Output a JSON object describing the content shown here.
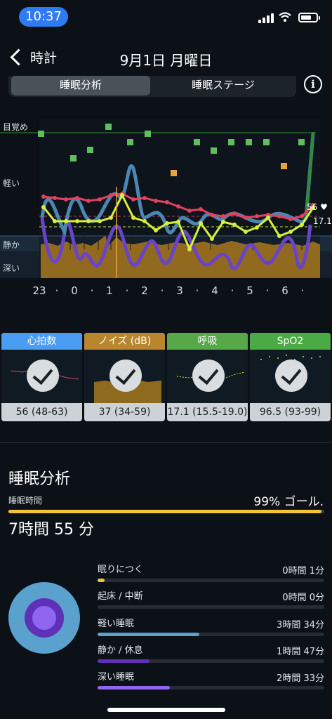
{
  "status_bar": {
    "time": "10:37"
  },
  "nav": {
    "back_label": "時計",
    "title": "9月1日 月曜日"
  },
  "segments": {
    "active": "睡眠分析",
    "inactive": "睡眠ステージ"
  },
  "info_icon": "i",
  "chart": {
    "y_labels": [
      "目覚め",
      "軽い",
      "静か",
      "深い"
    ],
    "x_labels": [
      "23",
      "·",
      "0",
      "·",
      "1",
      "·",
      "2",
      "·",
      "3",
      "·",
      "4",
      "·",
      "5",
      "·",
      "6",
      "·"
    ],
    "heart_value": "56",
    "breath_value": "17.1",
    "colors": {
      "heart": "#e0425f",
      "breath": "#d7f03c",
      "light": "#4c86b2",
      "deep": "#6a44c8",
      "noise": "#a8781e",
      "awake": "#2d8a33"
    }
  },
  "tiles": [
    {
      "title": "心拍数",
      "value": "56 (48-63)",
      "color": "#4a9bf2"
    },
    {
      "title": "ノイズ (dB)",
      "value": "37 (34-59)",
      "color": "#b7862d"
    },
    {
      "title": "呼吸",
      "value": "17.1 (15.5-19.0)",
      "color": "#58a84a"
    },
    {
      "title": "SpO2",
      "value": "96.5 (93-99)",
      "color": "#4caa46"
    }
  ],
  "analysis": {
    "title": "睡眠分析",
    "sleep_time_label": "睡眠時間",
    "goal_text": "99% ゴール.",
    "goal_percent": 99,
    "total": "7時間 55 分"
  },
  "stages": [
    {
      "name": "眠りにつく",
      "time": "0時間 1分",
      "fraction": 0.03,
      "color": "#f0c338"
    },
    {
      "name": "起床 / 中断",
      "time": "0時間 0分",
      "fraction": 0.0,
      "color": "#3a8f3d"
    },
    {
      "name": "軽い睡眠",
      "time": "3時間 34分",
      "fraction": 0.45,
      "color": "#5aa1ce"
    },
    {
      "name": "静か / 休息",
      "time": "1時間 47分",
      "fraction": 0.23,
      "color": "#5e31b8"
    },
    {
      "name": "深い睡眠",
      "time": "2時間 33分",
      "fraction": 0.32,
      "color": "#8e66f0"
    }
  ]
}
